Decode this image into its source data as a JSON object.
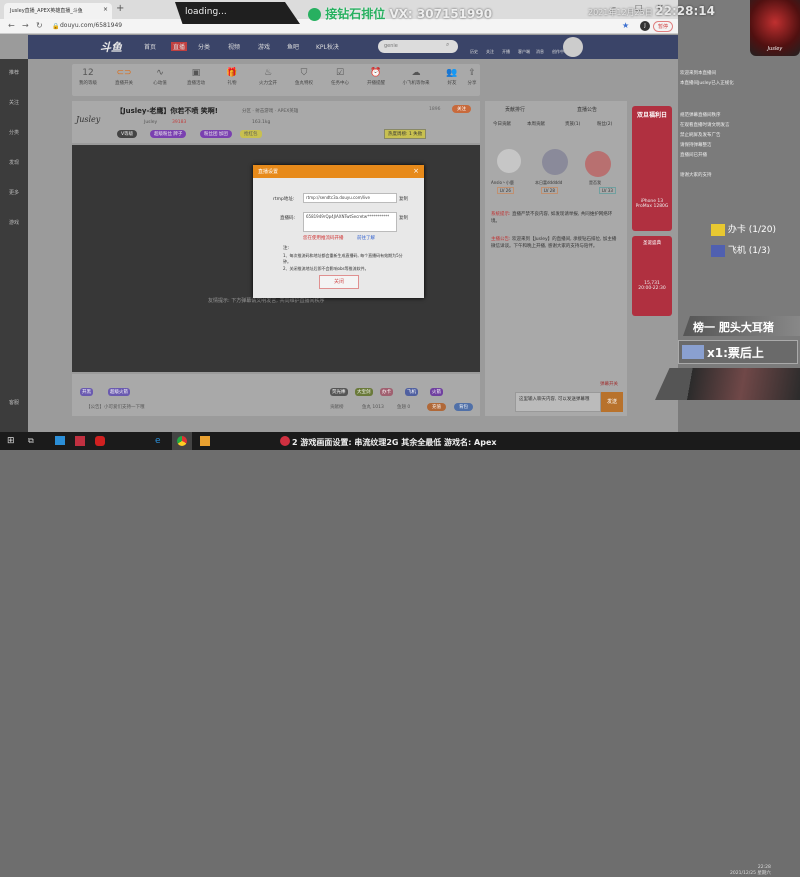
{
  "browser": {
    "tab_title": "Jusley直播_APEX英雄直播_斗鱼",
    "url": "douyu.com/6581949",
    "profile_initial": "J",
    "paused_label": "暂停"
  },
  "overlay": {
    "loading": "loading...",
    "wechat_text": "接钻石排位",
    "wechat_vx": "VX: 307151990",
    "date": "2021年12月25日",
    "time": "22:28:14",
    "avatar_name": "Jusley",
    "chat_lines": [
      "欢迎来到本直播间",
      "本直播间Jusley已入正规化",
      "规范弹幕直播间秩序",
      "在观看直播时请文明发言",
      "禁止刷屏及发布广告",
      "请保持弹幕整洁",
      "直播间已开播",
      "谢谢大家的支持"
    ],
    "tasks": [
      {
        "icon": "card-icon",
        "label": "办卡 (1/20)"
      },
      {
        "icon": "plane-icon",
        "label": "飞机 (1/3)"
      }
    ],
    "rank_banner": "榜一 肥头大耳猪",
    "gift_banner": "x1:票后上",
    "bottom_text": "2 游戏画面设置: 串流纹理2G 其余全最低  游戏名: Apex"
  },
  "nav": {
    "logo": "斗鱼",
    "items": [
      "首页",
      "直播",
      "分类",
      "视频",
      "游戏",
      "鱼吧",
      "KPL秋决"
    ],
    "search_placeholder": "genie",
    "right_items": [
      "历史",
      "关注",
      "开播",
      "客户端",
      "消息",
      "创作中心"
    ]
  },
  "sidebar": [
    "推荐",
    "关注",
    "分类",
    "发现",
    "更多",
    "游戏",
    "客服"
  ],
  "toolbar": {
    "level": "12",
    "level_label": "我的等级",
    "items": [
      "直播开关",
      "心动值",
      "直播活动",
      "礼物",
      "火力全开",
      "鱼丸特权",
      "任务中心",
      "开播提醒",
      "小飞机等你来",
      "好友",
      "分享"
    ]
  },
  "room": {
    "title": "【Jusley-老鹰】你若不喷 笑啊!",
    "category": "分区 · 射击游戏 · APEX英雄",
    "streamer": "Jusley",
    "heat": "39183",
    "weight": "163.1kg",
    "badges": [
      "V等级",
      "超级粉丝 牌子",
      "粉丝团 加团",
      "抢红包"
    ],
    "report": "举报",
    "follow_label": "关注",
    "follow_count": "1896",
    "hot_label": "热度周榜: 1 失败"
  },
  "video": {
    "caption": "友情提示: 下方弹幕请文明发言, 共同维护直播间秩序"
  },
  "dialog": {
    "title": "直播设置",
    "rtmp_label": "rtmp地址:",
    "rtmp_value": "rtmp://sendtc3a.douyu.com/live",
    "key_label": "直播码:",
    "key_value": "6581949rQp4JlAXNTwtSecretw***********",
    "copy": "复制",
    "warning": "您在使用推流码开播",
    "learn_more": "前往了解",
    "notes_title": "注:",
    "notes": [
      "1、每次推流码和地址都会重新生成直播码, 每个直播码有效期为5分钟。",
      "2、关闭推流地址后即不会影响obs等推流软件。"
    ],
    "close_label": "关闭"
  },
  "giftbar": {
    "left_gifts": [
      "开黑",
      "超级火箭"
    ],
    "right_gifts": [
      "荧光棒",
      "大宝剑",
      "办卡",
      "飞机",
      "火箭"
    ],
    "notice": "【公告】小可爱们支持一下哦",
    "stats": [
      "贡献榜",
      "鱼丸 1013",
      "鱼翅 0"
    ],
    "btn1": "充值",
    "btn2": "背包"
  },
  "rightpanel": {
    "head1": "贡献排行",
    "head2": "直播公告",
    "tabs": [
      "今日贡献",
      "本周贡献",
      "贵族(1)",
      "粉丝(2)"
    ],
    "ranks": [
      {
        "name": "Anslo丶小鹿",
        "level": "LV 26"
      },
      {
        "name": "本日富dddddd",
        "level": "LV 28"
      },
      {
        "name": "是否我",
        "level": "LV 33"
      }
    ],
    "notice1_tag": "系统提示:",
    "notice1": "直播严禁不良内容, 如发现请举报, 共同维护网络环境。",
    "notice2_tag": "主播公告:",
    "notice2": "欢迎来到【Jusley】的直播间, 承接钻石排位, 加主播微信详谈。下午和晚上开播, 感谢大家的支持与陪伴。",
    "chat_placeholder": "这里输入聊天内容, 可以发送弹幕哦",
    "send": "发送",
    "flag": "弹幕开关"
  },
  "ads": {
    "ad1_title": "双旦福利日",
    "ad1_text": "iPhone 13 ProMax 1280G",
    "ad2_title": "圣诞盛典",
    "ad2_count": "15,731",
    "ad2_time": "20:00-22:30"
  },
  "taskbar": {
    "time": "22:28",
    "date": "2021/12/25 星期六"
  }
}
